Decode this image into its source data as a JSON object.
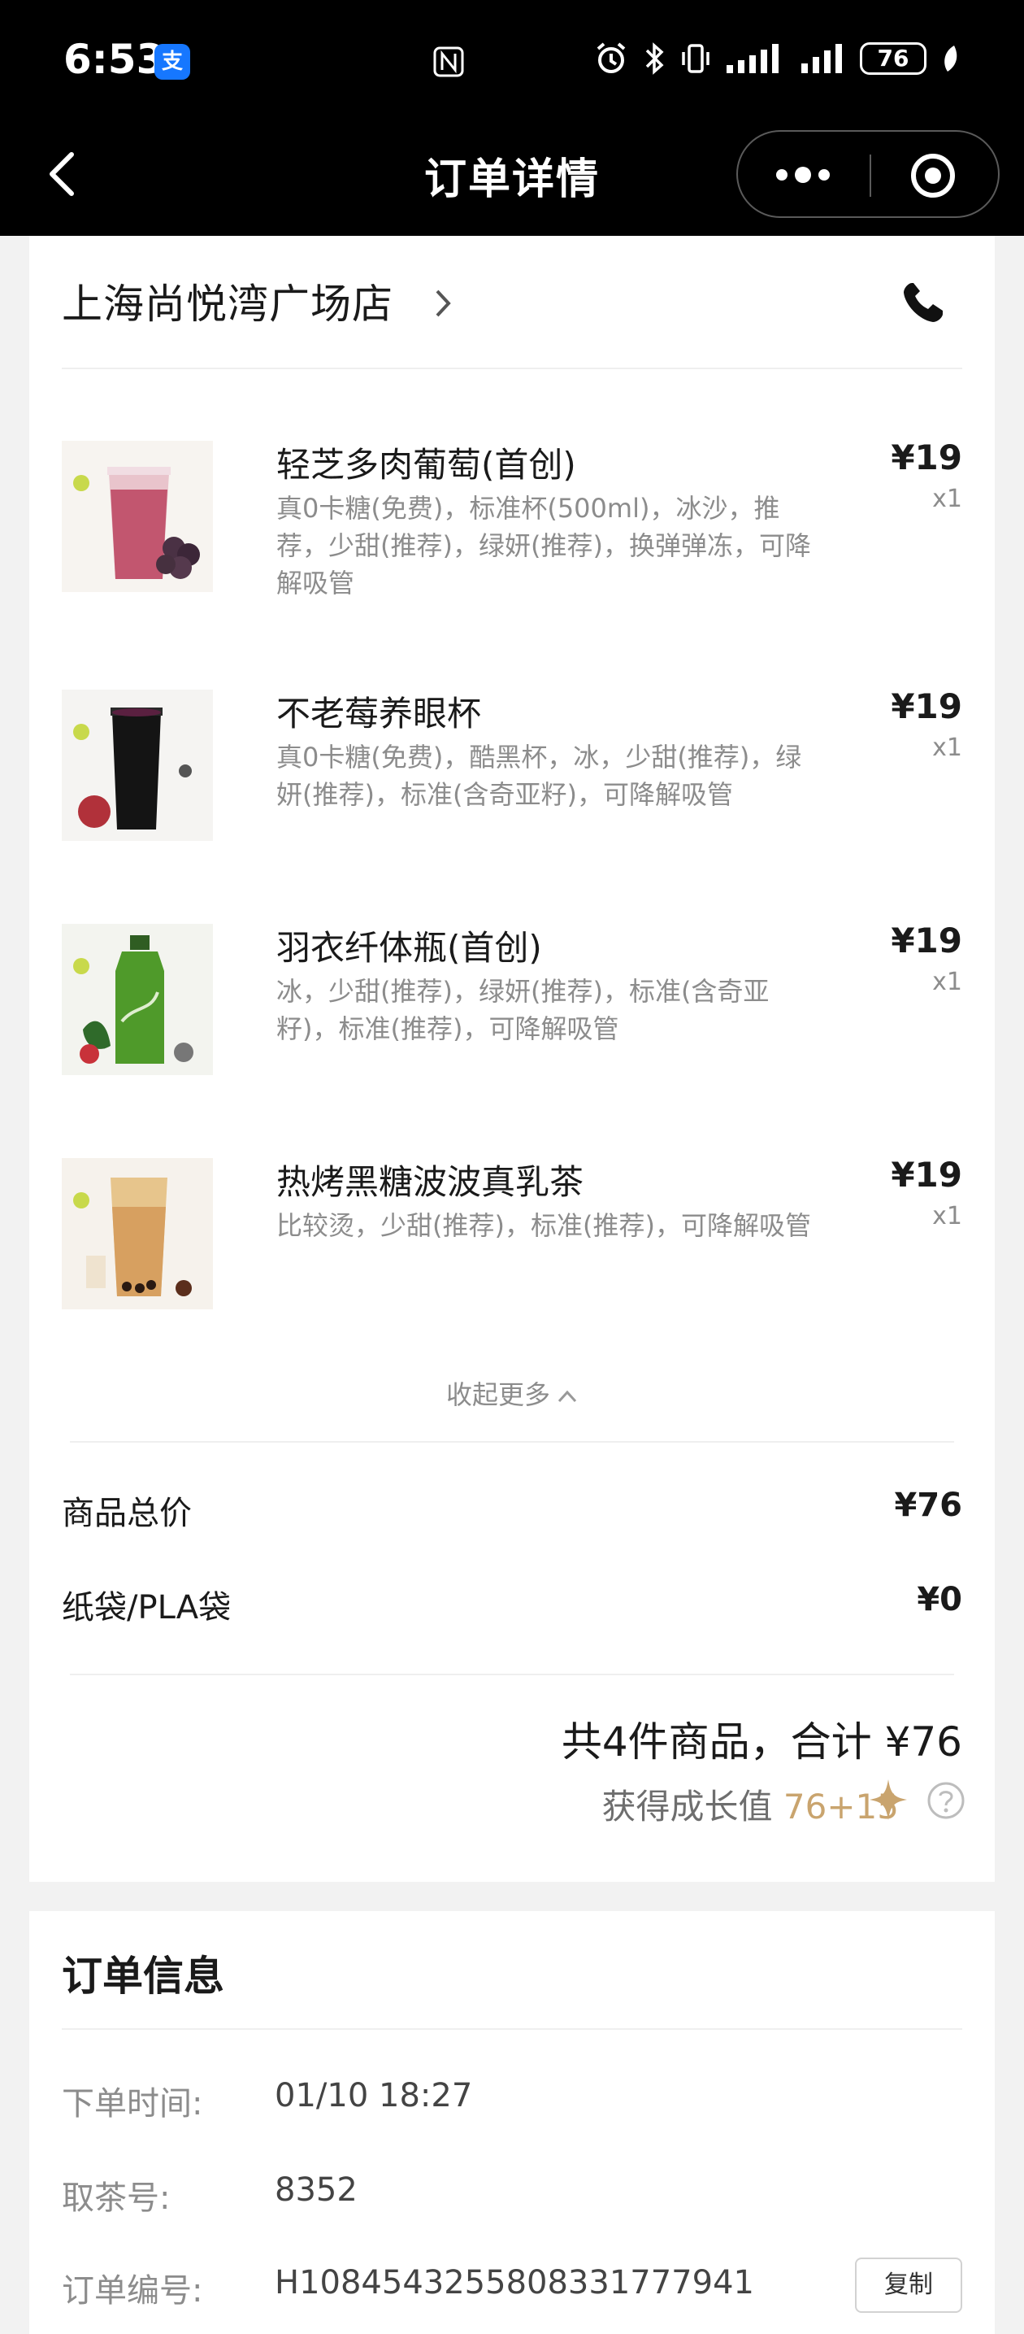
{
  "status_bar": {
    "time": "6:53",
    "alipay_badge": "支",
    "battery": "76"
  },
  "nav": {
    "title": "订单详情"
  },
  "store": {
    "name": "上海尚悦湾广场店"
  },
  "items": [
    {
      "name": "轻芝多肉葡萄(首创)",
      "desc": "真0卡糖(免费)，标准杯(500ml)，冰沙，推荐，少甜(推荐)，绿妍(推荐)，换弹弹冻，可降解吸管",
      "price": "¥19",
      "qty": "x1"
    },
    {
      "name": "不老莓养眼杯",
      "desc": "真0卡糖(免费)，酷黑杯，冰，少甜(推荐)，绿妍(推荐)，标准(含奇亚籽)，可降解吸管",
      "price": "¥19",
      "qty": "x1"
    },
    {
      "name": "羽衣纤体瓶(首创)",
      "desc": "冰，少甜(推荐)，绿妍(推荐)，标准(含奇亚籽)，标准(推荐)，可降解吸管",
      "price": "¥19",
      "qty": "x1"
    },
    {
      "name": "热烤黑糖波波真乳茶",
      "desc": "比较烫，少甜(推荐)，标准(推荐)，可降解吸管",
      "price": "¥19",
      "qty": "x1"
    }
  ],
  "collapse_label": "收起更多",
  "summary": {
    "goods_label": "商品总价",
    "goods_value": "¥76",
    "bag_label": "纸袋/PLA袋",
    "bag_value": "¥0",
    "total": "共4件商品，合计 ¥76",
    "growth_label": "获得成长值",
    "growth_points": "76+15"
  },
  "order_info": {
    "title": "订单信息",
    "time_label": "下单时间:",
    "time_value": "01/10 18:27",
    "pickup_label": "取茶号:",
    "pickup_value": "8352",
    "order_no_label": "订单编号:",
    "order_no_value": "H108454325580833177794​1",
    "copy_label": "复制"
  },
  "colors": {
    "accent_gold": "#c9a46e",
    "nav_bg": "#000000"
  }
}
